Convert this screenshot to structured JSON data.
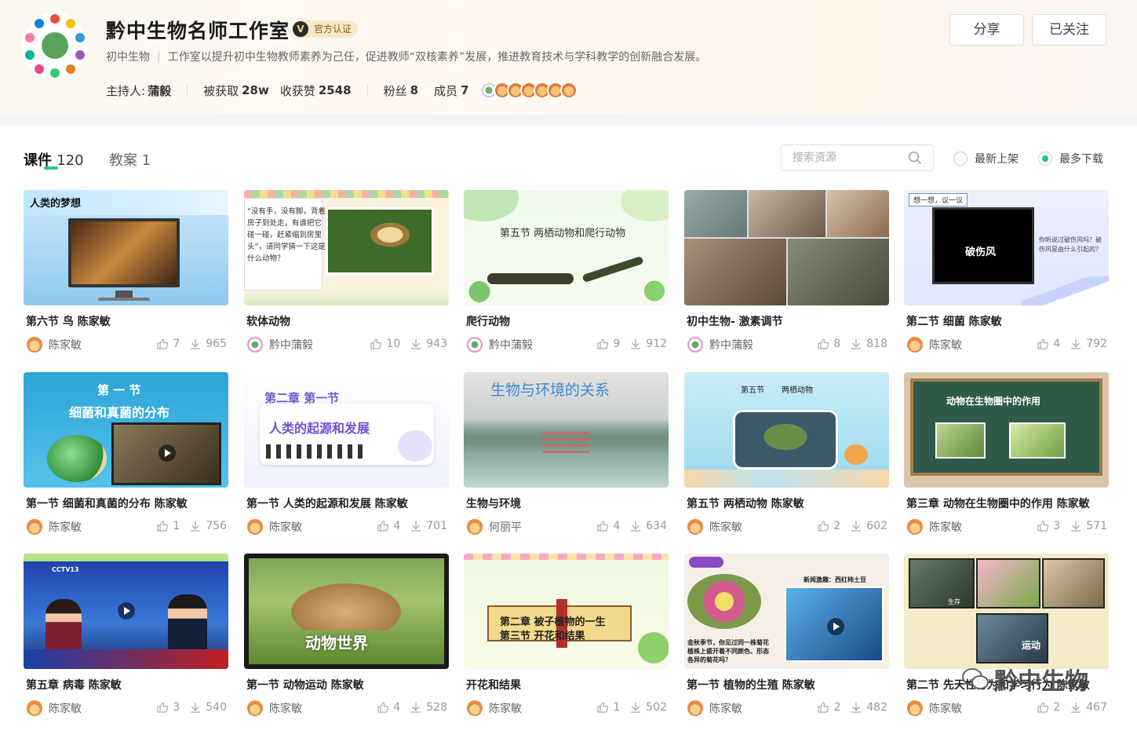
{
  "header": {
    "title": "黔中生物名师工作室",
    "verify_label": "官方认证",
    "verify_icon_letter": "V",
    "category": "初中生物",
    "description": "工作室以提升初中生物教师素养为己任，促进教师“双核素养”发展，推进教育技术与学科教学的创新融合发展。",
    "host_label": "主持人:",
    "host_name": "蒲毅",
    "obtained_label": "被获取",
    "obtained_value": "28w",
    "likes_label": "收获赞",
    "likes_value": "2548",
    "fans_label": "粉丝",
    "fans_value": "8",
    "members_label": "成员",
    "members_value": "7",
    "share_label": "分享",
    "follow_label": "已关注"
  },
  "tabs": [
    {
      "label": "课件",
      "count": "120"
    },
    {
      "label": "教案",
      "count": "1"
    }
  ],
  "search": {
    "placeholder": "搜索资源"
  },
  "sort": {
    "newest": "最新上架",
    "most": "最多下载"
  },
  "cards": [
    {
      "title": "第六节 鸟 陈家敏",
      "author": "陈家敏",
      "likes": "7",
      "downloads": "965",
      "thumb_text": "人类的梦想"
    },
    {
      "title": "软体动物",
      "author": "黔中蒲毅",
      "likes": "10",
      "downloads": "943",
      "thumb_text": "“没有手，没有脚，背着房子到处走，有谁把它碰一碰，赶紧缩到房里头”，请同学猜一下这是什么动物？"
    },
    {
      "title": "爬行动物",
      "author": "黔中蒲毅",
      "likes": "9",
      "downloads": "912",
      "thumb_text": "第五节 两栖动物和爬行动物"
    },
    {
      "title": "初中生物- 激素调节",
      "author": "黔中蒲毅",
      "likes": "8",
      "downloads": "818",
      "thumb_text": ""
    },
    {
      "title": "第二节 细菌 陈家敏",
      "author": "陈家敏",
      "likes": "4",
      "downloads": "792",
      "thumb_text": "想一想，议一议",
      "thumb_text2": "破伤风",
      "thumb_text3": "你听说过破伤风吗？破伤风是由什么引起的？"
    },
    {
      "title": "第一节 细菌和真菌的分布 陈家敏",
      "author": "陈家敏",
      "likes": "1",
      "downloads": "756",
      "thumb_text": "第 一 节",
      "thumb_text2": "细菌和真菌的分布"
    },
    {
      "title": "第一节 人类的起源和发展 陈家敏",
      "author": "陈家敏",
      "likes": "4",
      "downloads": "701",
      "thumb_text": "第二章  第一节",
      "thumb_text2": "人类的起源和发展"
    },
    {
      "title": "生物与环境",
      "author": "何丽平",
      "likes": "4",
      "downloads": "634",
      "thumb_text": "生物与环境的关系"
    },
    {
      "title": "第五节 两栖动物 陈家敏",
      "author": "陈家敏",
      "likes": "2",
      "downloads": "602",
      "thumb_text": "第五节",
      "thumb_text2": "两栖动物"
    },
    {
      "title": "第三章 动物在生物圈中的作用 陈家敏",
      "author": "陈家敏",
      "likes": "3",
      "downloads": "571",
      "thumb_text": "动物在生物圈中的作用"
    },
    {
      "title": "第五章 病毒 陈家敏",
      "author": "陈家敏",
      "likes": "3",
      "downloads": "540",
      "thumb_text": "CCTV13"
    },
    {
      "title": "第一节 动物运动 陈家敏",
      "author": "陈家敏",
      "likes": "4",
      "downloads": "528",
      "thumb_text": "动物世界"
    },
    {
      "title": "开花和结果",
      "author": "陈家敏",
      "likes": "1",
      "downloads": "502",
      "thumb_text": "第二章  被子植物的一生",
      "thumb_text2": "第三节  开花和结果"
    },
    {
      "title": "第一节 植物的生殖 陈家敏",
      "author": "陈家敏",
      "likes": "2",
      "downloads": "482",
      "thumb_text": "金秋季节，你见过同一株菊花植株上盛开着不同颜色、形态各异的菊花吗？",
      "thumb_text2": "新闻激趣：西红柿土豆"
    },
    {
      "title": "第二节 先天性行为和学习行为 陈家敏",
      "author": "陈家敏",
      "likes": "2",
      "downloads": "467",
      "thumb_text": "运动",
      "thumb_text2": "生存"
    }
  ],
  "watermark": "黔中生物",
  "colors": {
    "accent": "#27c39a",
    "radio_on": "#22c08b",
    "verify_bg": "#f7e9c8"
  }
}
